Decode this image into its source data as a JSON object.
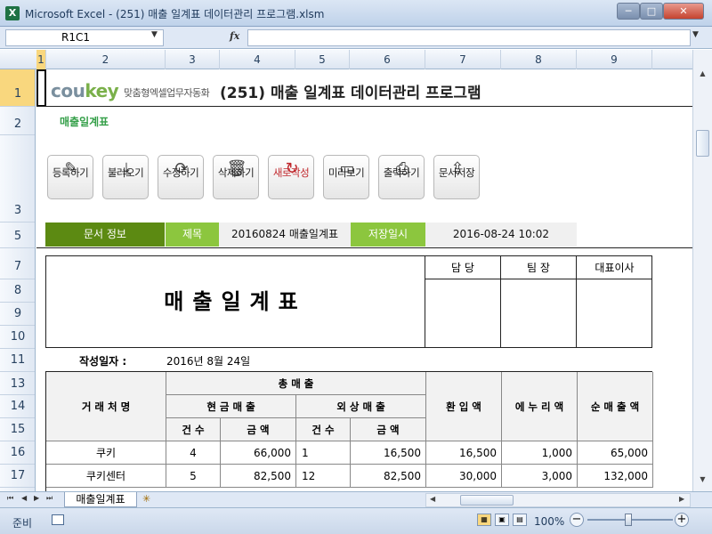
{
  "window": {
    "title": "Microsoft Excel - (251) 매출 일계표 데이터관리 프로그램.xlsm",
    "app_icon": "X",
    "min": "─",
    "max": "□",
    "close": "✕"
  },
  "formula_bar": {
    "name_box": "R1C1",
    "fx": "fx",
    "formula": ""
  },
  "columns": [
    "1",
    "2",
    "3",
    "4",
    "5",
    "6",
    "7",
    "8",
    "9"
  ],
  "rows": [
    "1",
    "2",
    "3",
    "5",
    "7",
    "8",
    "9",
    "10",
    "11",
    "13",
    "14",
    "15",
    "16",
    "17"
  ],
  "sheet": {
    "logo_main": "cou",
    "logo_accent": "key",
    "slogan": "맞춤형엑셀업무자동화",
    "title": "(251) 매출 일계표 데이터관리 프로그램",
    "subtitle": "매출일계표",
    "toolbar": [
      {
        "label": "등록하기",
        "icon": "pencil-icon",
        "glyph": "✎"
      },
      {
        "label": "불러오기",
        "icon": "download-icon",
        "glyph": "⤓"
      },
      {
        "label": "수정하기",
        "icon": "refresh-icon",
        "glyph": "⟳"
      },
      {
        "label": "삭제하기",
        "icon": "trash-icon",
        "glyph": "🗑"
      },
      {
        "label": "새로작성",
        "icon": "new-icon",
        "glyph": "↻"
      },
      {
        "label": "미리보기",
        "icon": "monitor-icon",
        "glyph": "▭"
      },
      {
        "label": "출력하기",
        "icon": "printer-icon",
        "glyph": "⎙"
      },
      {
        "label": "문서저장",
        "icon": "folder-upload-icon",
        "glyph": "⇪"
      }
    ],
    "info": {
      "doc_label": "문서 정보",
      "title_label": "제목",
      "title_value": "20160824 매출일계표",
      "saved_label": "저장일시",
      "saved_value": "2016-08-24 10:02"
    },
    "approval": {
      "title": "매출일계표",
      "headers": [
        "담 당",
        "팀 장",
        "대표이사"
      ]
    },
    "date_label": "작성일자 :",
    "date_value": "2016년 8월 24일",
    "table": {
      "h_client": "거 래 처 명",
      "h_total": "총        매        출",
      "h_cash": "현 금 매 출",
      "h_credit": "외 상 매 출",
      "h_count": "건 수",
      "h_amount": "금     액",
      "h_return": "환 입 액",
      "h_discount": "에 누 리 액",
      "h_net": "순 매 출 액",
      "rows": [
        {
          "client": "쿠키",
          "cash_count": "4",
          "cash_amount": "66,000",
          "credit_count": "1",
          "credit_amount": "16,500",
          "return": "16,500",
          "discount": "1,000",
          "net": "65,000"
        },
        {
          "client": "쿠키센터",
          "cash_count": "5",
          "cash_amount": "82,500",
          "credit_count": "12",
          "credit_amount": "82,500",
          "return": "30,000",
          "discount": "3,000",
          "net": "132,000"
        }
      ]
    }
  },
  "tabs": {
    "sheet_name": "매출일계표",
    "nav_first": "⏮",
    "nav_prev": "◀",
    "nav_next": "▶",
    "nav_last": "⏭",
    "new_sheet": "✳"
  },
  "status": {
    "ready": "준비",
    "zoom": "100%",
    "zoom_minus": "−",
    "zoom_plus": "+"
  }
}
